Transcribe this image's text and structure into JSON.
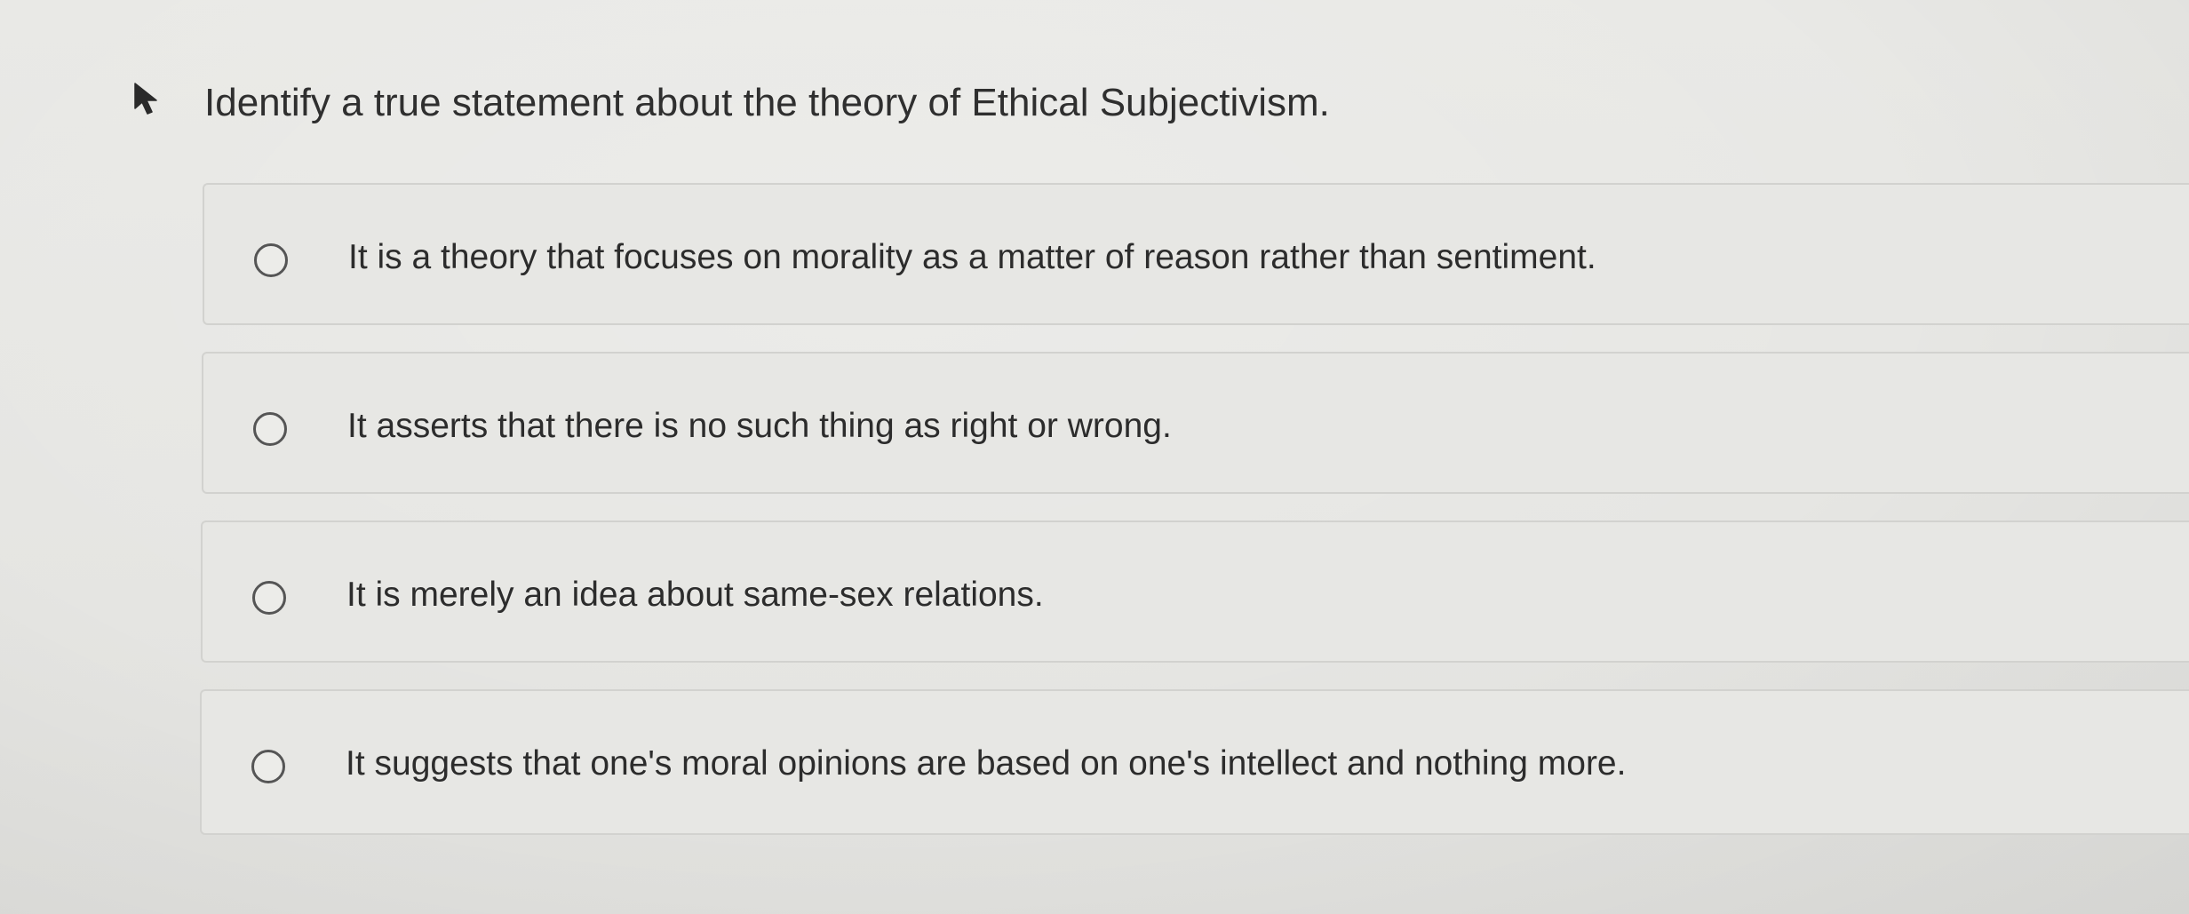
{
  "question": {
    "text": "Identify a true statement about the theory of Ethical Subjectivism."
  },
  "options": [
    {
      "label": "It is a theory that focuses on morality as a matter of reason rather than sentiment.",
      "selected": false
    },
    {
      "label": "It asserts that there is no such thing as right or wrong.",
      "selected": false
    },
    {
      "label": "It is merely an idea about same-sex relations.",
      "selected": false
    },
    {
      "label": "It suggests that one's moral opinions are based on one's intellect and nothing more.",
      "selected": false
    }
  ],
  "icons": {
    "cursor": "mouse-pointer-icon",
    "radio": "radio-button-empty"
  },
  "colors": {
    "background": "#e7e7e4",
    "option_border": "#d2d2cf",
    "text": "#2c2c2c",
    "radio_border": "#555555"
  }
}
